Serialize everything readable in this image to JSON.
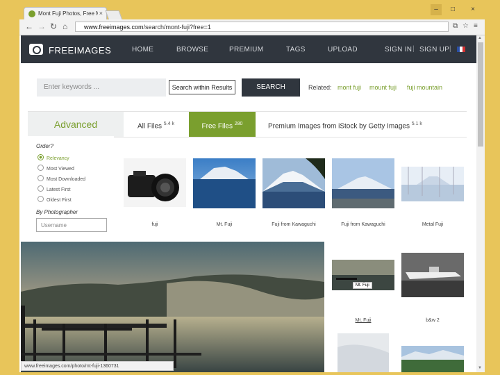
{
  "browser": {
    "tab_title": "Mont Fuji Photos, Free Mo",
    "tab_close": "×",
    "url_domain": "www.freeimages.com",
    "url_path": "/search/mont-fuji?free=1",
    "window_controls": [
      "–",
      "□",
      "×"
    ]
  },
  "site": {
    "logo": "FREEIMAGES",
    "nav": [
      "HOME",
      "BROWSE",
      "PREMIUM",
      "TAGS",
      "UPLOAD"
    ],
    "sign_in": "SIGN IN",
    "sign_up": "SIGN UP",
    "separator": "|"
  },
  "search": {
    "placeholder": "Enter keywords ...",
    "within_label": "Search within Results",
    "search_button": "SEARCH",
    "related_label": "Related:",
    "related": [
      "mont fuji",
      "mount fuji",
      "fuji mountain"
    ]
  },
  "filters": {
    "advanced": "Advanced",
    "all_files": "All Files",
    "all_count": "5.4 k",
    "free_files": "Free Files",
    "free_count": "280",
    "premium": "Premium Images from iStock by Getty Images",
    "premium_count": "5.1 k"
  },
  "sidebar": {
    "order_heading": "Order?",
    "order_options": [
      "Relevancy",
      "Most Viewed",
      "Most Downloaded",
      "Latest First",
      "Oldest First"
    ],
    "selected": "Relevancy",
    "photographer_heading": "By Photographer",
    "username_placeholder": "Username"
  },
  "results": {
    "captions": [
      "fuji",
      "Mt. Fuji",
      "Fuji from Kawaguchi",
      "Fuji from Kawaguchi",
      "Metal Fuji"
    ],
    "lower_captions": [
      "Mt. Fuji",
      "b&w 2"
    ],
    "hover_label": "Mt. Fuji"
  },
  "status_bar": "www.freeimages.com/photo/mt-fuji-1360731"
}
